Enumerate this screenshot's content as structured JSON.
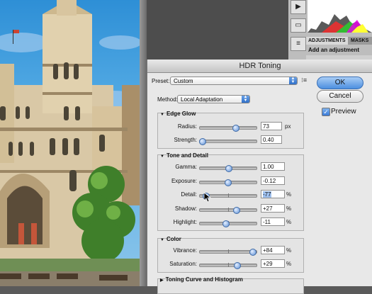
{
  "dialog": {
    "title": "HDR Toning",
    "preset_label": "Preset:",
    "preset_value": "Custom",
    "method_label": "Method:",
    "method_value": "Local Adaptation",
    "ok": "OK",
    "cancel": "Cancel",
    "preview_label": "Preview",
    "preview_checked": true
  },
  "edge_glow": {
    "title": "Edge Glow",
    "radius": {
      "label": "Radius:",
      "value": "73",
      "unit": "px",
      "level": 0.62
    },
    "strength": {
      "label": "Strength:",
      "value": "0.40",
      "level": 0.04
    }
  },
  "tone_detail": {
    "title": "Tone and Detail",
    "gamma": {
      "label": "Gamma:",
      "value": "1.00",
      "level": 0.5
    },
    "exposure": {
      "label": "Exposure:",
      "value": "-0.12",
      "level": 0.49
    },
    "detail": {
      "label": "Detail:",
      "value": "-77",
      "unit": "%",
      "level": 0.1
    },
    "shadow": {
      "label": "Shadow:",
      "value": "+27",
      "unit": "%",
      "level": 0.64
    },
    "highlight": {
      "label": "Highlight:",
      "value": "-11",
      "unit": "%",
      "level": 0.45
    }
  },
  "color": {
    "title": "Color",
    "vibrance": {
      "label": "Vibrance:",
      "value": "+84",
      "unit": "%",
      "level": 0.92
    },
    "saturation": {
      "label": "Saturation:",
      "value": "+29",
      "unit": "%",
      "level": 0.65
    }
  },
  "toning_curve": {
    "title": "Toning Curve and Histogram"
  },
  "panels": {
    "tab_adjustments": "ADJUSTMENTS",
    "tab_masks": "MASKS",
    "add_adjustment": "Add an adjustment"
  }
}
